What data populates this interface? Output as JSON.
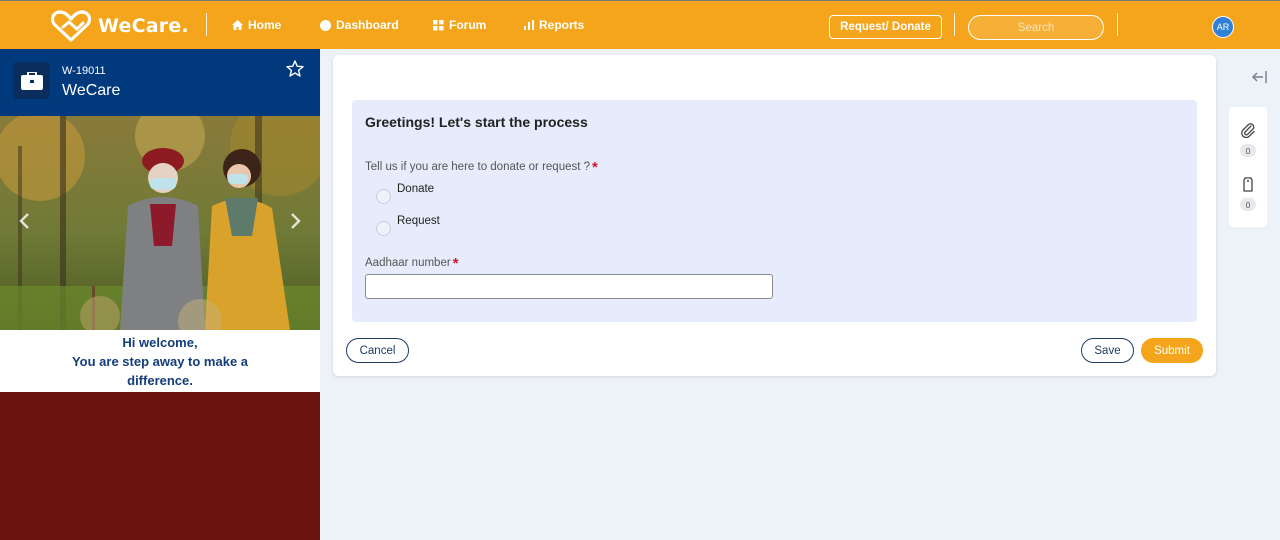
{
  "app": {
    "brand": "WeCare."
  },
  "nav": {
    "items": [
      {
        "label": "Home",
        "icon": "home-icon"
      },
      {
        "label": "Dashboard",
        "icon": "dashboard-icon"
      },
      {
        "label": "Forum",
        "icon": "forum-icon"
      },
      {
        "label": "Reports",
        "icon": "reports-icon"
      }
    ],
    "request_donate": "Request/ Donate",
    "search_placeholder": "Search",
    "avatar_initials": "AR"
  },
  "case": {
    "id": "W-19011",
    "title": "WeCare"
  },
  "welcome": {
    "line1": "Hi welcome,",
    "line2": "You are step away to make a difference."
  },
  "form": {
    "heading": "Greetings! Let's start the process",
    "question": "Tell us if you are here to donate or request ?",
    "options": [
      "Donate",
      "Request"
    ],
    "aadhaar_label": "Aadhaar number",
    "aadhaar_value": "",
    "required_marker": "*"
  },
  "actions": {
    "cancel": "Cancel",
    "save": "Save",
    "submit": "Submit"
  },
  "rail": {
    "attachments_count": "0",
    "tags_count": "0"
  },
  "colors": {
    "topbar": "#f5a51c",
    "header_blue": "#003a7d",
    "maroon": "#6a1410",
    "accent": "#f5a51c"
  }
}
